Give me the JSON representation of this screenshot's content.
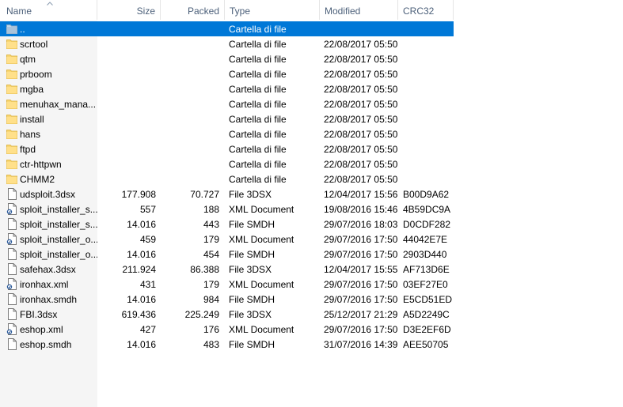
{
  "columns": {
    "name": "Name",
    "size": "Size",
    "packed": "Packed",
    "type": "Type",
    "modified": "Modified",
    "crc": "CRC32"
  },
  "rows": [
    {
      "name": "..",
      "size": "",
      "packed": "",
      "type": "Cartella di file",
      "modified": "",
      "crc": "",
      "icon": "folder-up-icon",
      "selected": true
    },
    {
      "name": "scrtool",
      "size": "",
      "packed": "",
      "type": "Cartella di file",
      "modified": "22/08/2017 05:50",
      "crc": "",
      "icon": "folder-icon"
    },
    {
      "name": "qtm",
      "size": "",
      "packed": "",
      "type": "Cartella di file",
      "modified": "22/08/2017 05:50",
      "crc": "",
      "icon": "folder-icon"
    },
    {
      "name": "prboom",
      "size": "",
      "packed": "",
      "type": "Cartella di file",
      "modified": "22/08/2017 05:50",
      "crc": "",
      "icon": "folder-icon"
    },
    {
      "name": "mgba",
      "size": "",
      "packed": "",
      "type": "Cartella di file",
      "modified": "22/08/2017 05:50",
      "crc": "",
      "icon": "folder-icon"
    },
    {
      "name": "menuhax_mana...",
      "size": "",
      "packed": "",
      "type": "Cartella di file",
      "modified": "22/08/2017 05:50",
      "crc": "",
      "icon": "folder-icon"
    },
    {
      "name": "install",
      "size": "",
      "packed": "",
      "type": "Cartella di file",
      "modified": "22/08/2017 05:50",
      "crc": "",
      "icon": "folder-icon"
    },
    {
      "name": "hans",
      "size": "",
      "packed": "",
      "type": "Cartella di file",
      "modified": "22/08/2017 05:50",
      "crc": "",
      "icon": "folder-icon"
    },
    {
      "name": "ftpd",
      "size": "",
      "packed": "",
      "type": "Cartella di file",
      "modified": "22/08/2017 05:50",
      "crc": "",
      "icon": "folder-icon"
    },
    {
      "name": "ctr-httpwn",
      "size": "",
      "packed": "",
      "type": "Cartella di file",
      "modified": "22/08/2017 05:50",
      "crc": "",
      "icon": "folder-icon"
    },
    {
      "name": "CHMM2",
      "size": "",
      "packed": "",
      "type": "Cartella di file",
      "modified": "22/08/2017 05:50",
      "crc": "",
      "icon": "folder-icon"
    },
    {
      "name": "udsploit.3dsx",
      "size": "177.908",
      "packed": "70.727",
      "type": "File 3DSX",
      "modified": "12/04/2017 15:56",
      "crc": "B00D9A62",
      "icon": "file-icon"
    },
    {
      "name": "sploit_installer_s...",
      "size": "557",
      "packed": "188",
      "type": "XML Document",
      "modified": "19/08/2016 15:46",
      "crc": "4B59DC9A",
      "icon": "xml-file-icon"
    },
    {
      "name": "sploit_installer_s...",
      "size": "14.016",
      "packed": "443",
      "type": "File SMDH",
      "modified": "29/07/2016 18:03",
      "crc": "D0CDF282",
      "icon": "file-icon"
    },
    {
      "name": "sploit_installer_o...",
      "size": "459",
      "packed": "179",
      "type": "XML Document",
      "modified": "29/07/2016 17:50",
      "crc": "44042E7E",
      "icon": "xml-file-icon"
    },
    {
      "name": "sploit_installer_o...",
      "size": "14.016",
      "packed": "454",
      "type": "File SMDH",
      "modified": "29/07/2016 17:50",
      "crc": "2903D440",
      "icon": "file-icon"
    },
    {
      "name": "safehax.3dsx",
      "size": "211.924",
      "packed": "86.388",
      "type": "File 3DSX",
      "modified": "12/04/2017 15:55",
      "crc": "AF713D6E",
      "icon": "file-icon"
    },
    {
      "name": "ironhax.xml",
      "size": "431",
      "packed": "179",
      "type": "XML Document",
      "modified": "29/07/2016 17:50",
      "crc": "03EF27E0",
      "icon": "xml-file-icon"
    },
    {
      "name": "ironhax.smdh",
      "size": "14.016",
      "packed": "984",
      "type": "File SMDH",
      "modified": "29/07/2016 17:50",
      "crc": "E5CD51ED",
      "icon": "file-icon"
    },
    {
      "name": "FBI.3dsx",
      "size": "619.436",
      "packed": "225.249",
      "type": "File 3DSX",
      "modified": "25/12/2017 21:29",
      "crc": "A5D2249C",
      "icon": "file-icon"
    },
    {
      "name": "eshop.xml",
      "size": "427",
      "packed": "176",
      "type": "XML Document",
      "modified": "29/07/2016 17:50",
      "crc": "D3E2EF6D",
      "icon": "xml-file-icon"
    },
    {
      "name": "eshop.smdh",
      "size": "14.016",
      "packed": "483",
      "type": "File SMDH",
      "modified": "31/07/2016 14:39",
      "crc": "AEE50705",
      "icon": "file-icon"
    }
  ],
  "colors": {
    "selection": "#0078d7",
    "header_text": "#4c607a",
    "folder": "#f8d775",
    "folder_shadow": "#e0b84a",
    "name_column_band": "#f5f5f5"
  }
}
